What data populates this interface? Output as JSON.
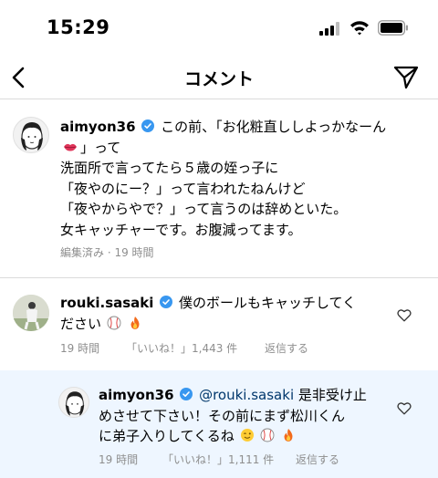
{
  "status_bar": {
    "time": "15:29"
  },
  "header": {
    "title": "コメント"
  },
  "caption": {
    "username": "aimyon36",
    "line1": "この前、「お化粧直ししよっかなーん",
    "line2": "」って",
    "line3": "洗面所で言ってたら５歳の姪っ子に",
    "line4": "「夜やのにー？」って言われたねんけど",
    "line5": "「夜やからやで？」って言うのは辞めといた。",
    "line6": "女キャッチャーです。お腹減ってます。",
    "meta": "編集済み · 19 時間"
  },
  "comments": [
    {
      "username": "rouki.sasaki",
      "line1": "僕のボールもキャッチしてく",
      "line2": "ださい",
      "time": "19 時間",
      "likes": "「いいね！」1,443 件",
      "reply": "返信する"
    },
    {
      "username": "aimyon36",
      "mention": "@rouki.sasaki",
      "line1": "是非受け止",
      "line2": "めさせて下さい！その前にまず松川くん",
      "line3": "に弟子入りしてくるね",
      "time": "19 時間",
      "likes": "「いいね！」1,111 件",
      "reply": "返信する"
    }
  ]
}
